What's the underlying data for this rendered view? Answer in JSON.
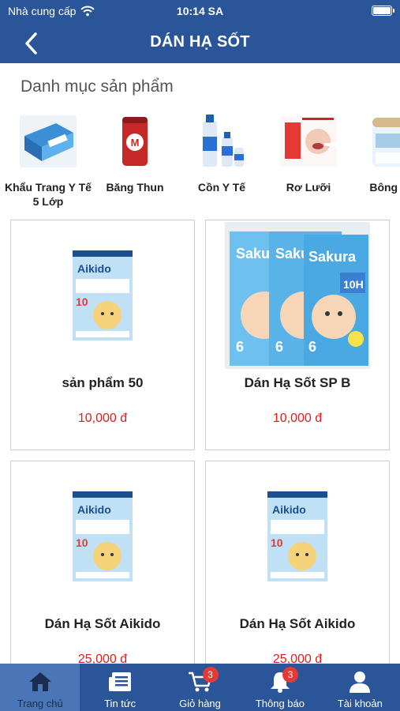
{
  "status_bar": {
    "carrier": "Nhà cung cấp",
    "time": "10:14 SA",
    "battery_level": 0.9
  },
  "nav": {
    "title": "DÁN HẠ SỐT"
  },
  "categories": {
    "heading": "Danh mục sản phẩm",
    "items": [
      {
        "label": "Khẩu Trang Y Tế 5 Lớp"
      },
      {
        "label": "Băng Thun"
      },
      {
        "label": "Cồn Y Tế"
      },
      {
        "label": "Rơ Lưỡi"
      },
      {
        "label": "Bông Ráy"
      }
    ]
  },
  "products": [
    {
      "name": "sản phẩm 50",
      "price": "10,000 đ",
      "image_icon": "aikido-package-icon"
    },
    {
      "name": "Dán Hạ Sốt SP B",
      "price": "10,000 đ",
      "image_icon": "sakura-package-icon"
    },
    {
      "name": "Dán Hạ Sốt Aikido",
      "price": "25,000 đ",
      "image_icon": "aikido-package-icon"
    },
    {
      "name": "Dán Hạ Sốt Aikido",
      "price": "25,000 đ",
      "image_icon": "aikido-package-icon"
    }
  ],
  "tabbar": {
    "items": [
      {
        "label": "Trang chủ",
        "icon": "home-icon"
      },
      {
        "label": "Tin tức",
        "icon": "news-icon"
      },
      {
        "label": "Giỏ hàng",
        "icon": "cart-icon",
        "badge": "3"
      },
      {
        "label": "Thông báo",
        "icon": "bell-icon",
        "badge": "3"
      },
      {
        "label": "Tài khoản",
        "icon": "user-icon"
      }
    ]
  },
  "colors": {
    "primary": "#2a5598",
    "active_tab": "#4a75b6",
    "price": "#d81e1e",
    "badge": "#e53935"
  }
}
